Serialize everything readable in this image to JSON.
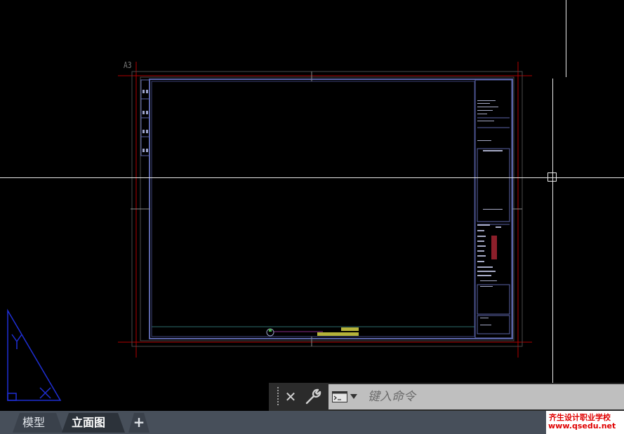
{
  "drawing": {
    "paper_size_label": "A3"
  },
  "command_line": {
    "placeholder": "键入命令",
    "value": ""
  },
  "layout_tabs": [
    {
      "label": "模型",
      "active": false
    },
    {
      "label": "立面图",
      "active": true
    }
  ],
  "add_tab_label": "+",
  "watermark": {
    "line1": "齐生设计职业学校",
    "line2": "www.qsedu.net"
  },
  "icons": {
    "close": "close-icon",
    "customize": "wrench-icon",
    "command_prompt": "command-prompt-icon",
    "recent_commands": "chevron-down-icon",
    "ucs": "ucs-triangle-icon"
  },
  "colors": {
    "model_space_bg": "#000000",
    "sheet_border": "#5b65a8",
    "margin_guides": "#b00000",
    "crosshair": "#e8e8e8",
    "command_field": "#bfbfbf",
    "tab_bar": "#474f5a",
    "ucs_icon": "#1f2fd6"
  }
}
